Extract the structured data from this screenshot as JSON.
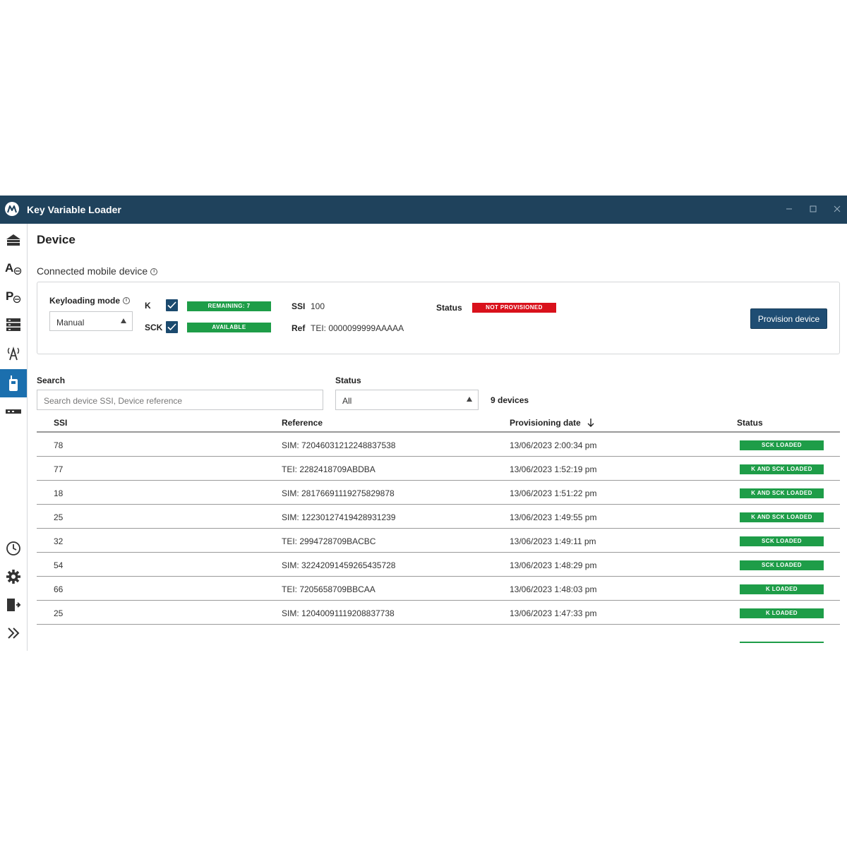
{
  "window": {
    "title": "Key Variable Loader",
    "controls": [
      "–",
      "☐",
      "✕"
    ]
  },
  "sidebar": {
    "items": [
      {
        "name": "home-icon",
        "active": false
      },
      {
        "name": "a-key-icon",
        "active": false
      },
      {
        "name": "p-key-icon",
        "active": false
      },
      {
        "name": "server-stack-icon",
        "active": false
      },
      {
        "name": "antenna-icon",
        "active": false
      },
      {
        "name": "radio-device-icon",
        "active": true
      },
      {
        "name": "card-reader-icon",
        "active": false
      }
    ],
    "bottom_items": [
      {
        "name": "history-clock-icon"
      },
      {
        "name": "settings-gear-icon"
      },
      {
        "name": "logout-icon"
      },
      {
        "name": "expand-chevrons-icon"
      }
    ]
  },
  "page": {
    "title": "Device",
    "section_label": "Connected mobile device"
  },
  "device_card": {
    "keyloading_mode_label": "Keyloading mode",
    "keyloading_mode_value": "Manual",
    "k_label": "K",
    "k_badge": "REMAINING: 7",
    "sck_label": "SCK",
    "sck_badge": "AVAILABLE",
    "ssi_label": "SSI",
    "ssi_value": "100",
    "ref_label": "Ref",
    "ref_value": "TEI: 0000099999AAAAA",
    "status_label": "Status",
    "status_badge": "NOT PROVISIONED",
    "provision_button": "Provision device"
  },
  "filters": {
    "search_label": "Search",
    "search_placeholder": "Search device SSI, Device reference",
    "status_label": "Status",
    "status_value": "All",
    "device_count": "9 devices"
  },
  "table": {
    "headers": {
      "ssi": "SSI",
      "reference": "Reference",
      "date": "Provisioning date",
      "status": "Status"
    },
    "rows": [
      {
        "ssi": "78",
        "reference": "SIM: 72046031212248837538",
        "date": "13/06/2023 2:00:34 pm",
        "status": "SCK LOADED"
      },
      {
        "ssi": "77",
        "reference": "TEI: 2282418709ABDBA",
        "date": "13/06/2023 1:52:19 pm",
        "status": "K AND SCK LOADED"
      },
      {
        "ssi": "18",
        "reference": "SIM: 28176691119275829878",
        "date": "13/06/2023 1:51:22 pm",
        "status": "K AND SCK LOADED"
      },
      {
        "ssi": "25",
        "reference": "SIM: 12230127419428931239",
        "date": "13/06/2023 1:49:55 pm",
        "status": "K AND SCK LOADED"
      },
      {
        "ssi": "32",
        "reference": "TEI: 2994728709BACBC",
        "date": "13/06/2023 1:49:11 pm",
        "status": "SCK LOADED"
      },
      {
        "ssi": "54",
        "reference": "SIM: 32242091459265435728",
        "date": "13/06/2023 1:48:29 pm",
        "status": "SCK LOADED"
      },
      {
        "ssi": "66",
        "reference": "TEI: 7205658709BBCAA",
        "date": "13/06/2023 1:48:03 pm",
        "status": "K LOADED"
      },
      {
        "ssi": "25",
        "reference": "SIM: 12040091119208837738",
        "date": "13/06/2023 1:47:33 pm",
        "status": "K LOADED"
      }
    ]
  },
  "colors": {
    "titlebar": "#1f425c",
    "accent": "#1b6fae",
    "success": "#1e9d48",
    "danger": "#d9111b",
    "button": "#1f4d73"
  }
}
